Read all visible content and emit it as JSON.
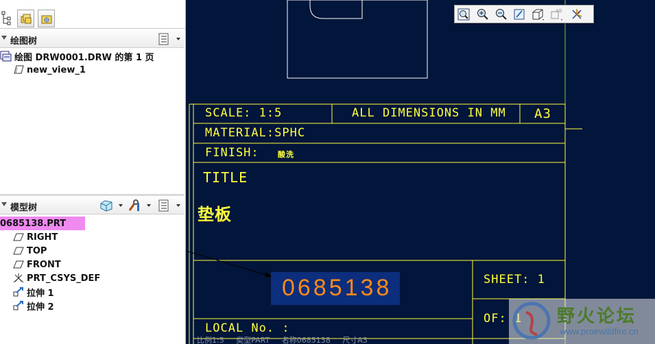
{
  "left_panel": {
    "drawing_tree": {
      "title": "绘图树",
      "items": [
        {
          "label": "绘图 DRW0001.DRW 的第 1 页",
          "icon": "drawing-sheet-icon"
        },
        {
          "label": "new_view_1",
          "icon": "view-icon"
        }
      ]
    },
    "model_tree": {
      "title": "模型树",
      "root": "0685138.PRT",
      "items": [
        {
          "label": "RIGHT",
          "icon": "datum-plane-icon"
        },
        {
          "label": "TOP",
          "icon": "datum-plane-icon"
        },
        {
          "label": "FRONT",
          "icon": "datum-plane-icon"
        },
        {
          "label": "PRT_CSYS_DEF",
          "icon": "csys-icon"
        },
        {
          "label": "拉伸 1",
          "icon": "extrude-icon"
        },
        {
          "label": "拉伸 2",
          "icon": "extrude-icon"
        }
      ]
    }
  },
  "title_block": {
    "scale": "SCALE:  1:5",
    "dimensions": "ALL DIMENSIONS IN MM",
    "size": "A3",
    "material": "MATERIAL:SPHC",
    "finish_label": "FINISH:",
    "finish_value": "酸洗",
    "title_label": "TITLE",
    "title_value": "垫板",
    "part_number": "0685138",
    "sheet": "SHEET: 1",
    "of": "OF: 1",
    "local_no": "LOCAL No. :"
  },
  "status_line": "比例1:5  类型PART  名称0685138  尺寸A3",
  "watermark": {
    "title": "野火论坛",
    "url": "www.proewildfire.cn"
  },
  "colors": {
    "canvas_bg": "#02153a",
    "line": "#ffff3c",
    "highlight": "#ef8aef",
    "part_number": "#ff8a1a"
  }
}
